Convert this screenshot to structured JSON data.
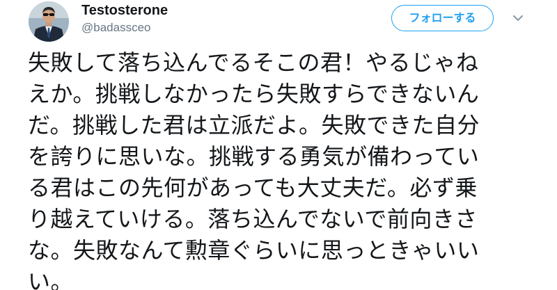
{
  "author": {
    "display_name": "Testosterone",
    "handle": "@badassceo",
    "avatar_icon": "profile-photo-man-in-suit"
  },
  "actions": {
    "follow_label": "フォローする",
    "menu_icon": "chevron-down-icon"
  },
  "tweet": {
    "lines": [
      "失敗して落ち込んでるそこの君！やるじゃね",
      "えか。挑戦しなかったら失敗すらできないん",
      "だ。挑戦した君は立派だよ。失敗できた自分",
      "を誇りに思いな。挑戦する勇気が備わってい",
      "る君はこの先何があっても大丈夫だ。必ず乗",
      "り越えていける。落ち込んでないで前向きさ",
      "な。失敗なんて勲章ぐらいに思っときゃいい",
      "い。"
    ]
  },
  "colors": {
    "accent": "#1da1f2",
    "text": "#14171a",
    "secondary_text": "#657786"
  }
}
